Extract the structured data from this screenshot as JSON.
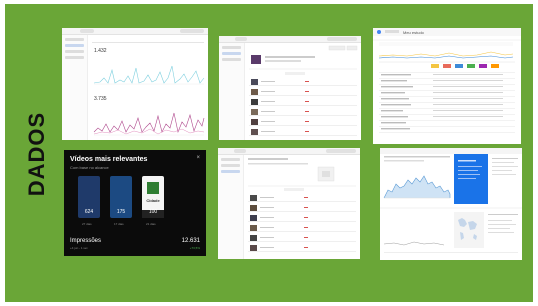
{
  "slide": {
    "title": "DADOS",
    "background_color": "#6aa637"
  },
  "youtube_card": {
    "title": "Vídeos mais relevantes",
    "subtitle": "Com base no alcance",
    "videos": [
      {
        "count": "624",
        "caption": "27 dias"
      },
      {
        "count": "175",
        "caption": "17 dias"
      },
      {
        "count": "100",
        "caption": "21 dias"
      }
    ],
    "metric_label": "Impressões",
    "metric_value": "12.631",
    "metric_sub": "+4 jun - 1 set",
    "metric_change": "+73,5%",
    "thumbnail_label": "Cidade"
  },
  "dashboard_search": {
    "title": "Meu estudo"
  }
}
